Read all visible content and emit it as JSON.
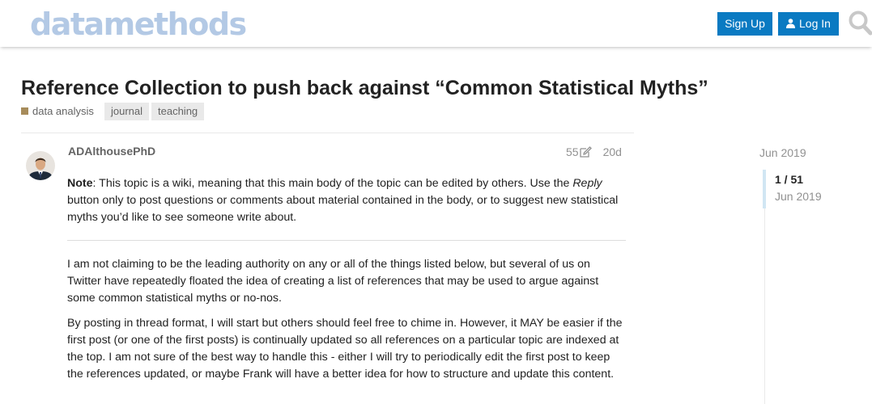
{
  "header": {
    "logo_text": "datamethods",
    "signup_label": "Sign Up",
    "login_label": "Log In",
    "icons": [
      "user-icon",
      "search-icon"
    ]
  },
  "topic": {
    "title": "Reference Collection to push back against “Common Statistical Myths”",
    "category": "data analysis",
    "category_color": "#a78c5b",
    "tags": [
      "journal",
      "teaching"
    ]
  },
  "post": {
    "username": "ADAlthousePhD",
    "edit_count": "55",
    "age": "20d",
    "note_label": "Note",
    "note_text_1": ": This topic is a wiki, meaning that this main body of the topic can be edited by others. Use the ",
    "note_reply": "Reply",
    "note_text_2": " button only to post questions or comments about material contained in the body, or to suggest new statistical myths you’d like to see someone write about.",
    "paragraph_1": "I am not claiming to be the leading authority on any or all of the things listed below, but several of us on Twitter have repeatedly floated the idea of creating a list of references that may be used to argue against some common statistical myths or no-nos.",
    "paragraph_2": "By posting in thread format, I will start but others should feel free to chime in. However, it MAY be easier if the first post (or one of the first posts) is continually updated so all references on a particular topic are indexed at the top. I am not sure of the best way to handle this - either I will try to periodically edit the first post to keep the references updated, or maybe Frank will have a better idea for how to structure and update this content."
  },
  "timeline": {
    "start_date": "Jun 2019",
    "position": "1 / 51",
    "current_date": "Jun 2019"
  },
  "colors": {
    "button_bg": "#0a7ac2",
    "logo": "#b3c9e5",
    "timeline_handle": "#d1e6f3"
  }
}
